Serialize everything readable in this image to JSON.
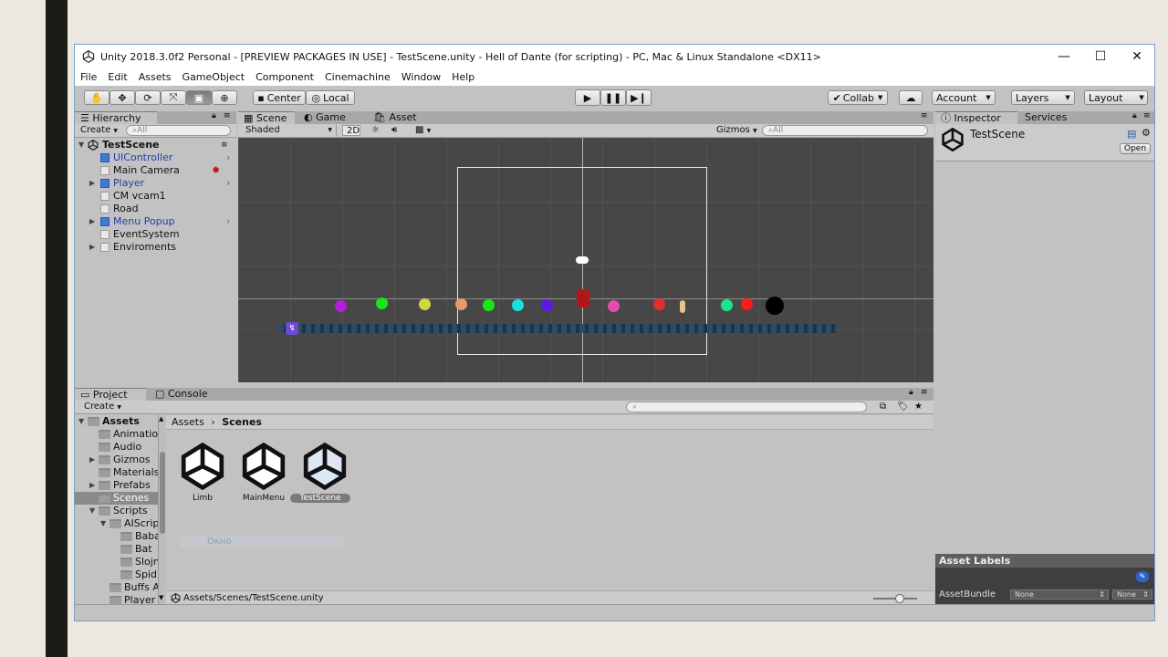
{
  "window": {
    "title": "Unity 2018.3.0f2 Personal - [PREVIEW PACKAGES IN USE] - TestScene.unity - Hell of Dante (for scripting) - PC, Mac & Linux Standalone <DX11>",
    "minimize": "—",
    "maximize": "☐",
    "close": "✕"
  },
  "menu": [
    "File",
    "Edit",
    "Assets",
    "GameObject",
    "Component",
    "Cinemachine",
    "Window",
    "Help"
  ],
  "toolbar": {
    "center": "Center",
    "local": "Local",
    "collab": "Collab",
    "account": "Account",
    "layers": "Layers",
    "layout": "Layout"
  },
  "hierarchy": {
    "tab": "Hierarchy",
    "create": "Create",
    "search_placeholder": "All",
    "scene_name": "TestScene",
    "items": [
      {
        "label": "UIController",
        "prefab": true,
        "expandable": false,
        "chevron": true
      },
      {
        "label": "Main Camera",
        "prefab": false,
        "expandable": false,
        "chevron": false
      },
      {
        "label": "Player",
        "prefab": true,
        "expandable": true,
        "chevron": true
      },
      {
        "label": "CM vcam1",
        "prefab": false,
        "expandable": false,
        "chevron": false
      },
      {
        "label": "Road",
        "prefab": false,
        "expandable": false,
        "chevron": false
      },
      {
        "label": "Menu Popup",
        "prefab": true,
        "expandable": true,
        "chevron": true
      },
      {
        "label": "EventSystem",
        "prefab": false,
        "expandable": false,
        "chevron": false
      },
      {
        "label": "Enviroments",
        "prefab": false,
        "expandable": true,
        "chevron": false
      }
    ]
  },
  "scene": {
    "tabs": [
      "Scene",
      "Game",
      "Asset Store"
    ],
    "shading": "Shaded",
    "mode2d": "2D",
    "gizmos": "Gizmos",
    "search_placeholder": "All",
    "dot_colors": [
      "#b31fd6",
      "#19e619",
      "#d4d43f",
      "#e59a6a",
      "#19e619",
      "#19e0e0",
      "#5a19e6",
      "#e64ab3",
      "#e03030",
      "#19e68c",
      "#ff1919",
      "#000000"
    ]
  },
  "project": {
    "tabs": [
      "Project",
      "Console"
    ],
    "create": "Create",
    "tree": [
      {
        "label": "Assets",
        "depth": 0,
        "arrow": "▼",
        "bold": true
      },
      {
        "label": "Animation",
        "depth": 1,
        "arrow": ""
      },
      {
        "label": "Audio",
        "depth": 1,
        "arrow": ""
      },
      {
        "label": "Gizmos",
        "depth": 1,
        "arrow": "▶"
      },
      {
        "label": "Materials",
        "depth": 1,
        "arrow": ""
      },
      {
        "label": "Prefabs",
        "depth": 1,
        "arrow": "▶"
      },
      {
        "label": "Scenes",
        "depth": 1,
        "arrow": "",
        "selected": true
      },
      {
        "label": "Scripts",
        "depth": 1,
        "arrow": "▼"
      },
      {
        "label": "AIScripts",
        "depth": 2,
        "arrow": "▼"
      },
      {
        "label": "Baba",
        "depth": 3,
        "arrow": ""
      },
      {
        "label": "Bat",
        "depth": 3,
        "arrow": ""
      },
      {
        "label": "Slojn",
        "depth": 3,
        "arrow": ""
      },
      {
        "label": "Spid",
        "depth": 3,
        "arrow": ""
      },
      {
        "label": "Buffs A",
        "depth": 2,
        "arrow": ""
      },
      {
        "label": "Player",
        "depth": 2,
        "arrow": ""
      }
    ],
    "breadcrumb": [
      "Assets",
      "Scenes"
    ],
    "assets": [
      "Limb",
      "MainMenu",
      "TestScene"
    ],
    "ghost_label": "Окно",
    "status_path": "Assets/Scenes/TestScene.unity"
  },
  "inspector": {
    "tabs": [
      "Inspector",
      "Services"
    ],
    "object_name": "TestScene",
    "open": "Open",
    "asset_labels": "Asset Labels",
    "assetbundle": "AssetBundle",
    "bundle_value": "None",
    "variant_value": "None"
  }
}
